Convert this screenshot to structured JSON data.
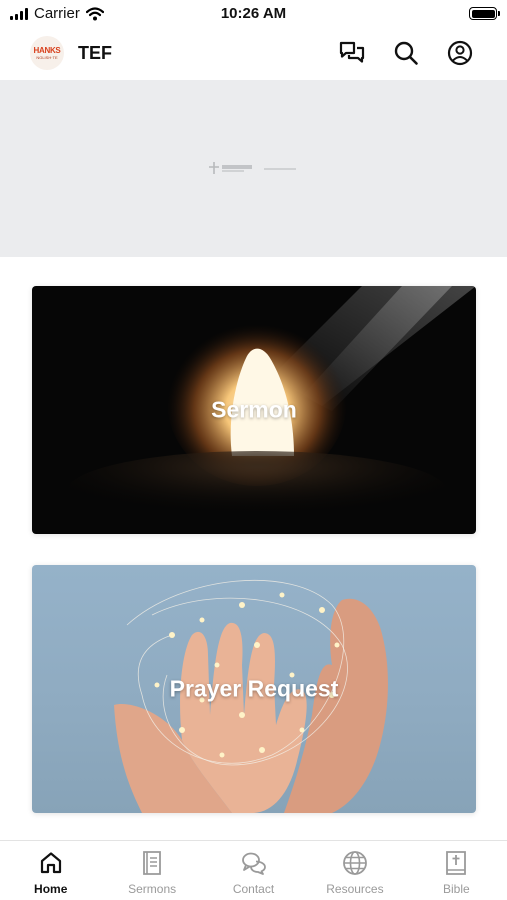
{
  "status_bar": {
    "carrier": "Carrier",
    "time": "10:26 AM"
  },
  "header": {
    "logo_text": "HANKS",
    "logo_subtext": "NGLISH·TE",
    "title": "TEF",
    "actions": [
      {
        "icon": "chat-bubbles-icon"
      },
      {
        "icon": "search-icon"
      },
      {
        "icon": "account-icon"
      }
    ]
  },
  "cards": [
    {
      "label": "Sermon"
    },
    {
      "label": "Prayer Request"
    }
  ],
  "tab_bar": {
    "active_tab": "Home",
    "tabs": [
      {
        "label": "Home",
        "icon": "home-icon"
      },
      {
        "label": "Sermons",
        "icon": "book-icon"
      },
      {
        "label": "Contact",
        "icon": "chat-bubbles-icon"
      },
      {
        "label": "Resources",
        "icon": "globe-icon"
      },
      {
        "label": "Bible",
        "icon": "bible-icon"
      }
    ]
  }
}
